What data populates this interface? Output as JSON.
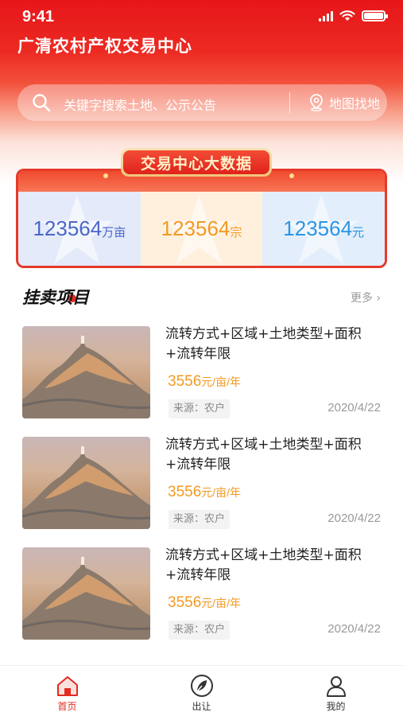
{
  "status_bar": {
    "time": "9:41"
  },
  "header": {
    "title": "广清农村产权交易中心",
    "search_placeholder": "关键字搜索土地、公示公告",
    "map_label": "地图找地"
  },
  "stats": {
    "badge": "交易中心大数据",
    "items": [
      {
        "value": "123564",
        "unit": "万亩"
      },
      {
        "value": "123564",
        "unit": "宗"
      },
      {
        "value": "123564",
        "unit": "元"
      }
    ]
  },
  "listings": {
    "title": "挂卖项目",
    "more": "更多 ›",
    "items": [
      {
        "name": "流转方式+区域+土地类型+面积+流转年限",
        "price": "3556",
        "price_unit": "元/亩/年",
        "source": "来源：农户",
        "date": "2020/4/22"
      },
      {
        "name": "流转方式+区域+土地类型+面积+流转年限",
        "price": "3556",
        "price_unit": "元/亩/年",
        "source": "来源：农户",
        "date": "2020/4/22"
      },
      {
        "name": "流转方式+区域+土地类型+面积+流转年限",
        "price": "3556",
        "price_unit": "元/亩/年",
        "source": "来源：农户",
        "date": "2020/4/22"
      }
    ]
  },
  "tabbar": {
    "items": [
      {
        "label": "首页",
        "icon": "home-icon",
        "active": true
      },
      {
        "label": "出让",
        "icon": "leaf-icon",
        "active": false
      },
      {
        "label": "我的",
        "icon": "user-icon",
        "active": false
      }
    ]
  },
  "colors": {
    "brand_red": "#e22b22",
    "price_orange": "#f39a23",
    "stat_blue": "#4a67c9",
    "stat_sky": "#2b95e3"
  }
}
